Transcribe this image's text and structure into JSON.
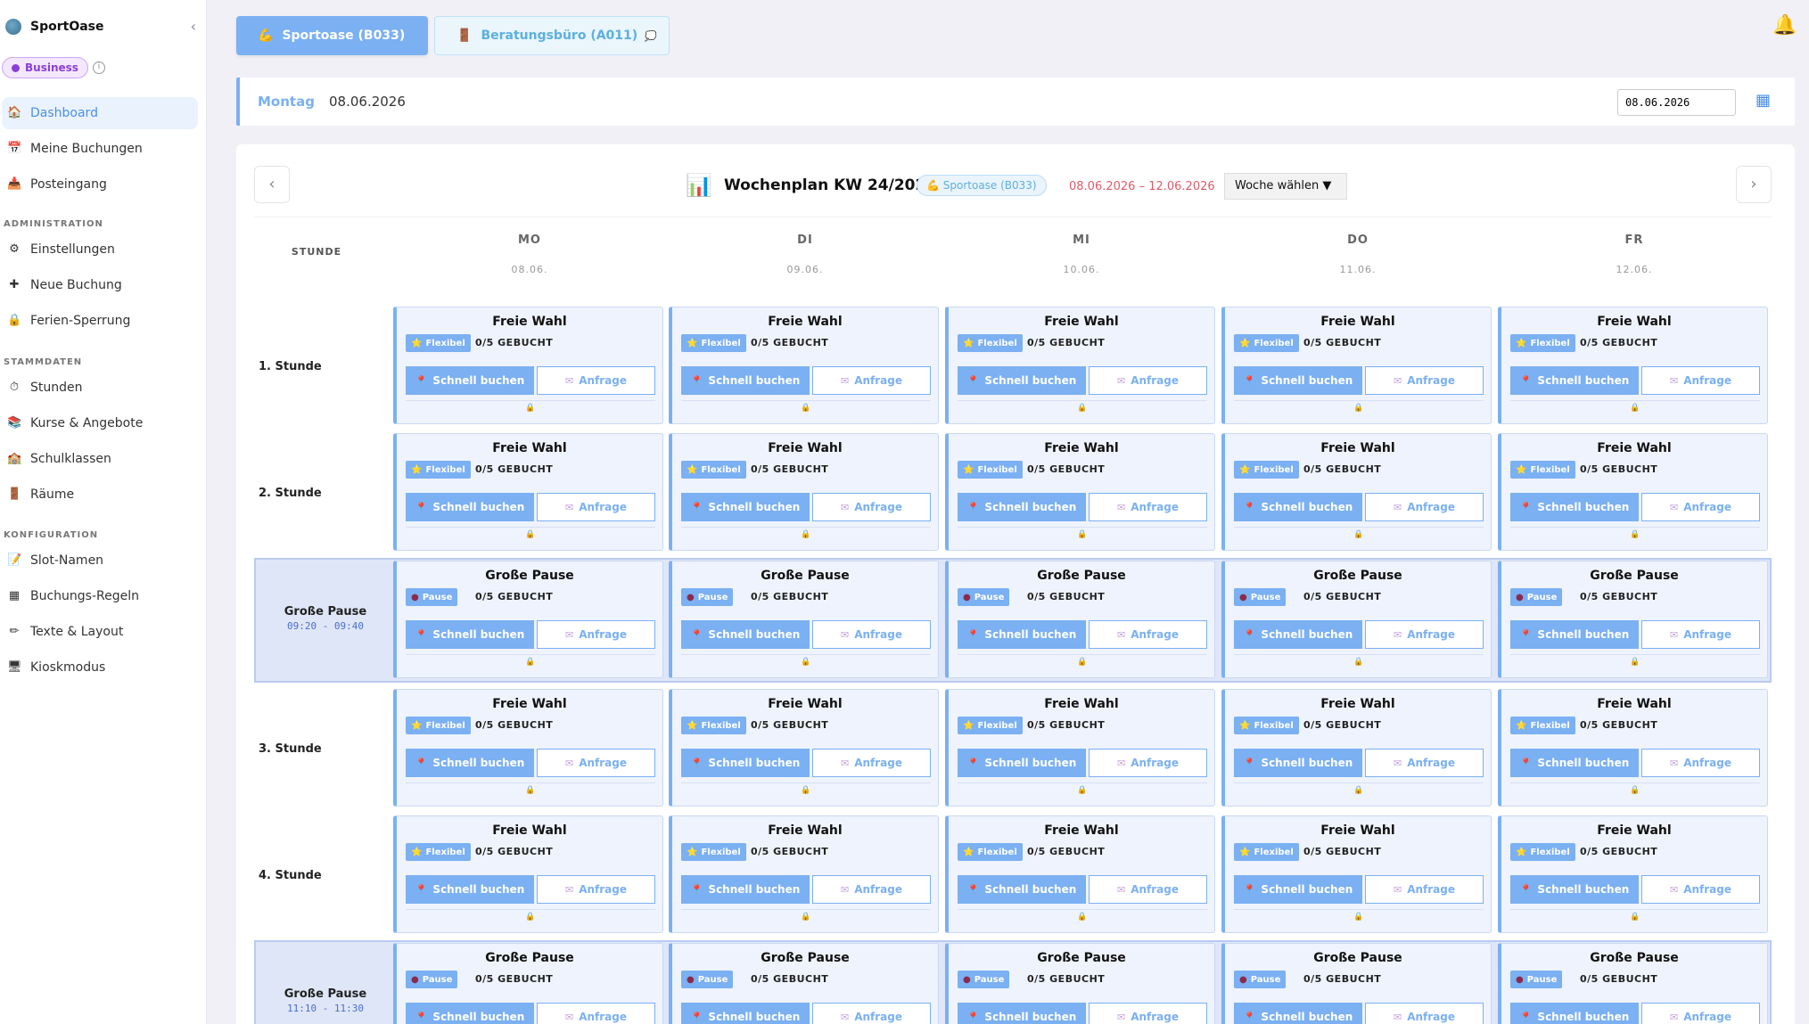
{
  "sidebar": {
    "brand": "SportOase",
    "collapse": "‹",
    "plan": "Business",
    "info": "i",
    "items": [
      {
        "label": "Dashboard",
        "icon": "🏠",
        "active": true
      },
      {
        "label": "Meine Buchungen",
        "icon": "📅"
      },
      {
        "label": "Posteingang",
        "icon": "📥"
      }
    ],
    "sections": [
      {
        "title": "ADMINISTRATION",
        "items": [
          {
            "label": "Einstellungen",
            "icon": "⚙"
          },
          {
            "label": "Neue Buchung",
            "icon": "✚"
          },
          {
            "label": "Ferien-Sperrung",
            "icon": "🔒"
          }
        ]
      },
      {
        "title": "STAMMDATEN",
        "items": [
          {
            "label": "Stunden",
            "icon": "⏱"
          },
          {
            "label": "Kurse & Angebote",
            "icon": "📚"
          },
          {
            "label": "Schulklassen",
            "icon": "🏫"
          },
          {
            "label": "Räume",
            "icon": "🚪"
          }
        ]
      },
      {
        "title": "KONFIGURATION",
        "items": [
          {
            "label": "Slot-Namen",
            "icon": "📝"
          },
          {
            "label": "Buchungs-Regeln",
            "icon": "▦"
          },
          {
            "label": "Texte & Layout",
            "icon": "✏"
          },
          {
            "label": "Kioskmodus",
            "icon": "🖥"
          }
        ]
      }
    ]
  },
  "tabs": [
    {
      "label": "Sportoase (B033)",
      "icon": "💪"
    },
    {
      "label": "Beratungsbüro (A011)",
      "icon": "🚪",
      "extra": "💭"
    }
  ],
  "bell": "🔔",
  "datebar": {
    "day": "Montag",
    "date": "08.06.2026",
    "input_value": "08.06.2026",
    "calendar_icon": "▦"
  },
  "week": {
    "prev": "‹",
    "next": "›",
    "icon": "📊",
    "title": "Wochenplan KW 24/2026",
    "room": "💪 Sportoase (B033)",
    "range": "08.06.2026 – 12.06.2026",
    "select": "Woche wählen  ▼"
  },
  "grid": {
    "stunde_header": "STUNDE",
    "days": [
      {
        "day": "MO",
        "date": "08.06."
      },
      {
        "day": "DI",
        "date": "09.06."
      },
      {
        "day": "MI",
        "date": "10.06."
      },
      {
        "day": "DO",
        "date": "11.06."
      },
      {
        "day": "FR",
        "date": "12.06."
      }
    ],
    "rows": [
      {
        "label": "1. Stunde",
        "type": "normal",
        "cell_title": "Freie Wahl",
        "tag": "Flexibel",
        "tag_icon": "⭐"
      },
      {
        "label": "2. Stunde",
        "type": "normal",
        "cell_title": "Freie Wahl",
        "tag": "Flexibel",
        "tag_icon": "⭐"
      },
      {
        "label": "Große Pause",
        "time": "09:20 - 09:40",
        "type": "pause",
        "cell_title": "Große Pause",
        "tag": "Pause",
        "tag_icon": "●"
      },
      {
        "label": "3. Stunde",
        "type": "normal",
        "cell_title": "Freie Wahl",
        "tag": "Flexibel",
        "tag_icon": "⭐"
      },
      {
        "label": "4. Stunde",
        "type": "normal",
        "cell_title": "Freie Wahl",
        "tag": "Flexibel",
        "tag_icon": "⭐"
      },
      {
        "label": "Große Pause",
        "time": "11:10 - 11:30",
        "type": "pause",
        "cell_title": "Große Pause",
        "tag": "Pause",
        "tag_icon": "●"
      }
    ],
    "count_text": "0/5 GEBUCHT",
    "book_label": "Schnell buchen",
    "book_icon": "📍",
    "request_label": "Anfrage",
    "request_icon": "✉",
    "lock_icon": "🔒"
  }
}
